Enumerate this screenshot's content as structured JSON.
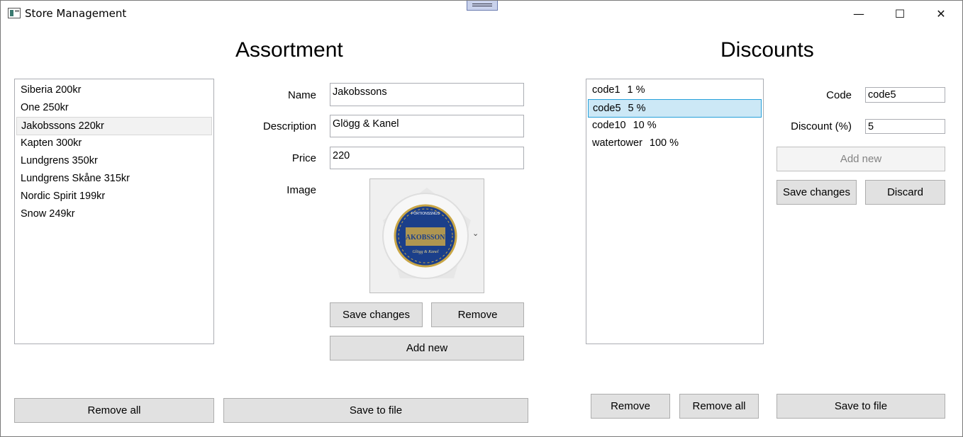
{
  "window": {
    "title": "Store Management",
    "minimize_glyph": "—",
    "maximize_glyph": "☐",
    "close_glyph": "✕"
  },
  "assortment": {
    "heading": "Assortment",
    "items": [
      {
        "label": "Siberia 200kr"
      },
      {
        "label": "One 250kr"
      },
      {
        "label": "Jakobssons 220kr"
      },
      {
        "label": "Kapten 300kr"
      },
      {
        "label": "Lundgrens 350kr"
      },
      {
        "label": "Lundgrens Skåne 315kr"
      },
      {
        "label": "Nordic Spirit 199kr"
      },
      {
        "label": "Snow 249kr"
      }
    ],
    "highlighted_index": 2,
    "form": {
      "name_label": "Name",
      "name_value": "Jakobssons",
      "description_label": "Description",
      "description_value": "Glögg & Kanel",
      "price_label": "Price",
      "price_value": "220",
      "image_label": "Image",
      "image_can_top": "PORTIONSSNUS",
      "image_can_brand": "JAKOBSSONS",
      "image_can_flavor": "Glögg & Kanel",
      "save_changes": "Save changes",
      "remove": "Remove",
      "add_new": "Add new"
    },
    "remove_all": "Remove all",
    "save_to_file": "Save to file"
  },
  "discounts": {
    "heading": "Discounts",
    "items": [
      {
        "code": "code1",
        "percent": "1 %"
      },
      {
        "code": "code5",
        "percent": "5 %"
      },
      {
        "code": "code10",
        "percent": "10 %"
      },
      {
        "code": "watertower",
        "percent": "100 %"
      }
    ],
    "selected_index": 1,
    "form": {
      "code_label": "Code",
      "code_value": "code5",
      "discount_label": "Discount (%)",
      "discount_value": "5",
      "add_new": "Add new",
      "add_new_enabled": false,
      "save_changes": "Save changes",
      "discard": "Discard"
    },
    "remove": "Remove",
    "remove_all": "Remove all",
    "save_to_file": "Save to file"
  },
  "colors": {
    "selection_bg": "#cce8f6",
    "selection_border": "#26a0da",
    "button_bg": "#e1e1e1",
    "can_blue": "#1b3f8a",
    "can_gold": "#c9a646"
  }
}
